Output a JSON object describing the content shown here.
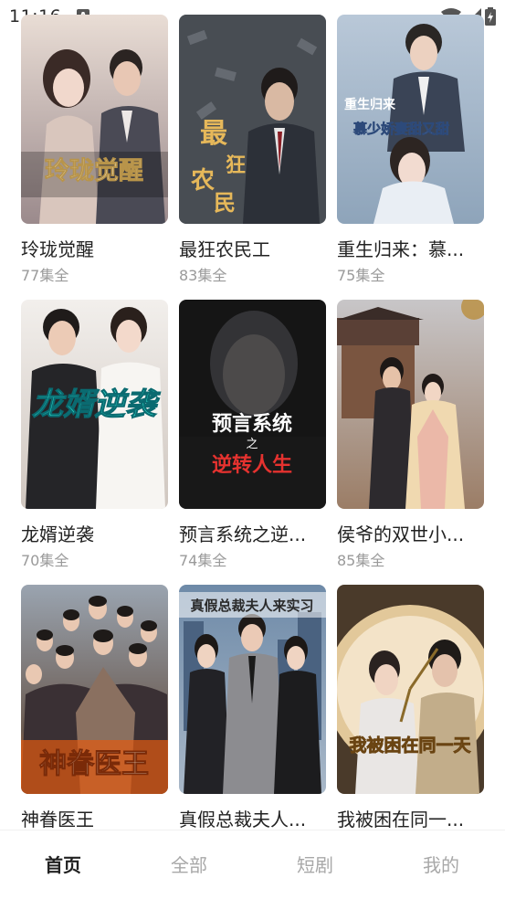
{
  "status": {
    "time": "11:16",
    "a_badge": "A"
  },
  "dramas": [
    {
      "title": "玲珑觉醒",
      "count": "77集全",
      "poster_text": "玲珑觉醒"
    },
    {
      "title": "最狂农民工",
      "count": "83集全",
      "poster_text": "最狂农民工"
    },
    {
      "title": "重生归来：慕...",
      "count": "75集全",
      "poster_text": "重生归来",
      "poster_sub": "慕少娇妻甜又甜"
    },
    {
      "title": "龙婿逆袭",
      "count": "70集全",
      "poster_text": "龙婿逆袭"
    },
    {
      "title": "预言系统之逆...",
      "count": "74集全",
      "poster_text": "预言系统",
      "poster_mid": "之",
      "poster_sub": "逆转人生"
    },
    {
      "title": "侯爷的双世小...",
      "count": "85集全"
    },
    {
      "title": "神眷医王",
      "count": "",
      "poster_text": "神眷医王"
    },
    {
      "title": "真假总裁夫人...",
      "count": "",
      "poster_text": "真假总裁夫人来实习"
    },
    {
      "title": "我被困在同一...",
      "count": "",
      "poster_text": "我被困在同一天"
    }
  ],
  "tabs": [
    {
      "label": "首页",
      "active": true
    },
    {
      "label": "全部",
      "active": false
    },
    {
      "label": "短剧",
      "active": false
    },
    {
      "label": "我的",
      "active": false
    }
  ]
}
